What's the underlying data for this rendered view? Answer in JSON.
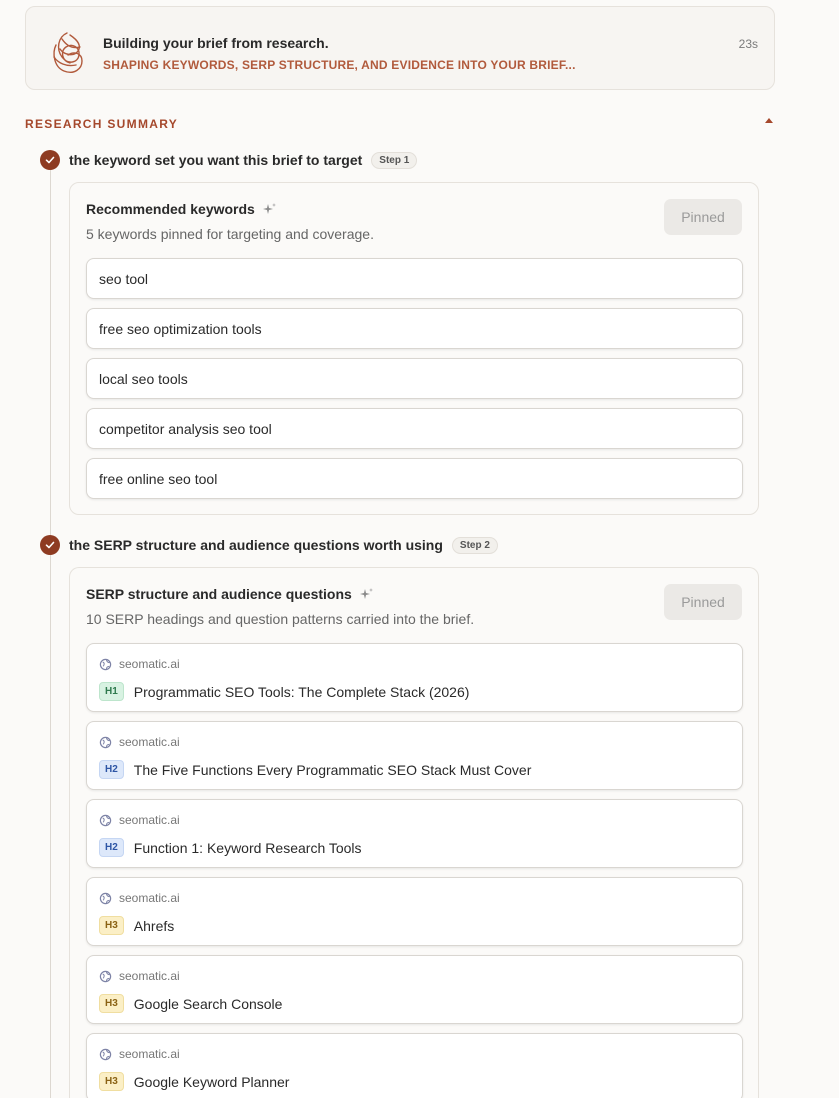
{
  "status": {
    "title": "Building your brief from research.",
    "subtitle": "SHAPING KEYWORDS, SERP STRUCTURE, AND EVIDENCE INTO YOUR BRIEF...",
    "elapsed": "23s"
  },
  "section": {
    "label": "RESEARCH SUMMARY"
  },
  "steps": [
    {
      "title": "the keyword set you want this brief to target",
      "badge": "Step 1",
      "panel": {
        "title": "Recommended keywords",
        "description": "5 keywords pinned for targeting and coverage.",
        "button": "Pinned",
        "keywords": [
          "seo tool",
          "free seo optimization tools",
          "local seo tools",
          "competitor analysis seo tool",
          "free online seo tool"
        ]
      }
    },
    {
      "title": "the SERP structure and audience questions worth using",
      "badge": "Step 2",
      "panel": {
        "title": "SERP structure and audience questions",
        "description": "10 SERP headings and question patterns carried into the brief.",
        "button": "Pinned",
        "items": [
          {
            "source": "seomatic.ai",
            "level": "H1",
            "text": "Programmatic SEO Tools: The Complete Stack (2026)"
          },
          {
            "source": "seomatic.ai",
            "level": "H2",
            "text": "The Five Functions Every Programmatic SEO Stack Must Cover"
          },
          {
            "source": "seomatic.ai",
            "level": "H2",
            "text": "Function 1: Keyword Research Tools"
          },
          {
            "source": "seomatic.ai",
            "level": "H3",
            "text": "Ahrefs"
          },
          {
            "source": "seomatic.ai",
            "level": "H3",
            "text": "Google Search Console"
          },
          {
            "source": "seomatic.ai",
            "level": "H3",
            "text": "Google Keyword Planner"
          }
        ]
      }
    }
  ],
  "colors": {
    "accent": "#a5482c",
    "check": "#8e3b22",
    "h1": "#2f7a4e",
    "h2": "#2d55a5",
    "h3": "#8a6214"
  },
  "icons": {
    "logo": "scribble-logo-icon",
    "check": "check-circle-icon",
    "sparkle": "sparkle-icon",
    "globe": "globe-icon",
    "collapse": "chevron-up-icon"
  }
}
